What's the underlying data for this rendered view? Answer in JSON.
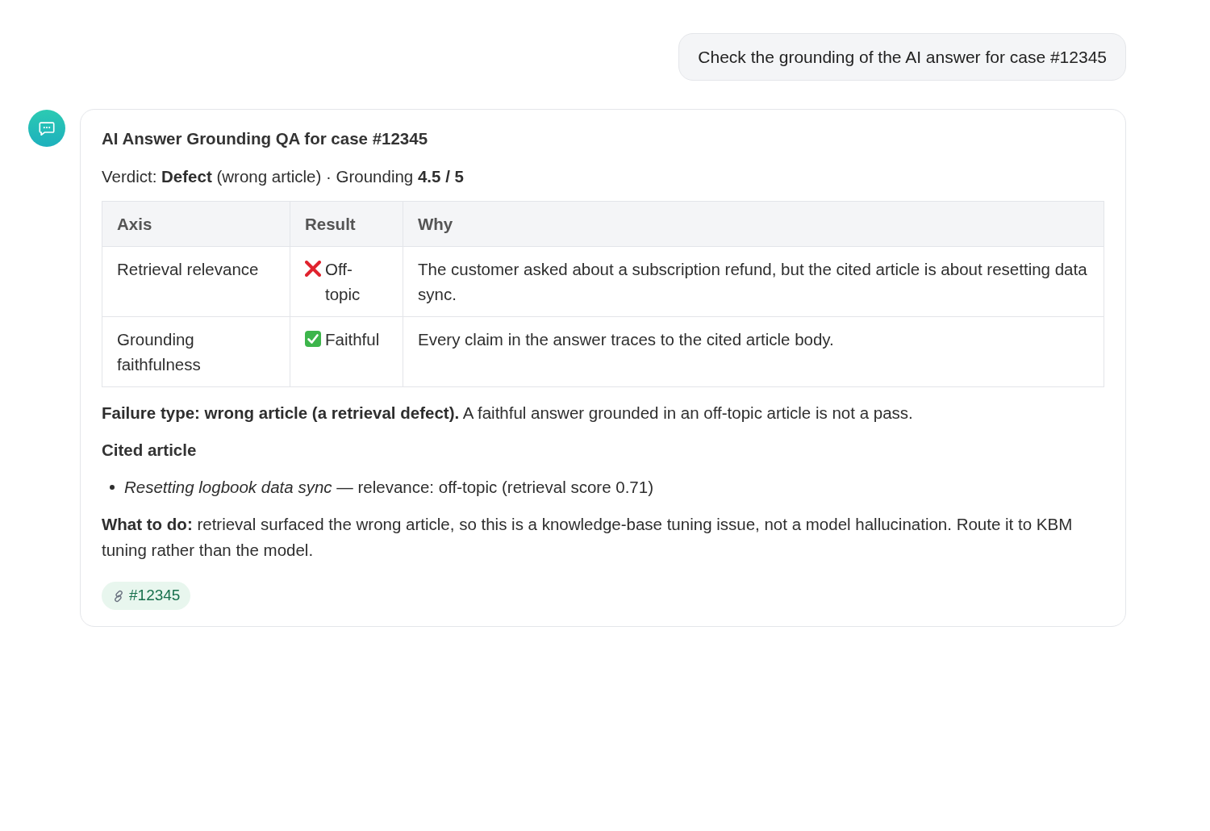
{
  "user_message": {
    "text": "Check the grounding of the AI answer for case #12345"
  },
  "assistant_message": {
    "title": "AI Answer Grounding QA for case #12345",
    "verdict": "Verdict: **Defect** (wrong article) · Grounding **4.5 / 5**",
    "table": {
      "columns": [
        "Axis",
        "Result",
        "Why"
      ],
      "rows": [
        {
          "axis": "Retrieval relevance",
          "result": {
            "kind": "fail",
            "label": "Off-topic"
          },
          "why": "The customer asked about a subscription refund, but the cited article is about resetting data sync."
        },
        {
          "axis": "Grounding faithfulness",
          "result": {
            "kind": "pass",
            "label": "Faithful"
          },
          "why": "Every claim in the answer traces to the cited article body."
        }
      ]
    },
    "failure_note": "**Failure type: wrong article (a retrieval defect).** A faithful answer grounded in an off-topic article is not a pass.",
    "cited_heading": "Cited article",
    "cited_articles": [
      "*Resetting logbook data sync* — relevance: off-topic (retrieval score 0.71)"
    ],
    "action_note": "**What to do:** retrieval surfaced the wrong article, so this is a knowledge-base tuning issue, not a model hallucination. Route it to KBM tuning rather than the model.",
    "case_link": {
      "label": "#12345"
    }
  }
}
